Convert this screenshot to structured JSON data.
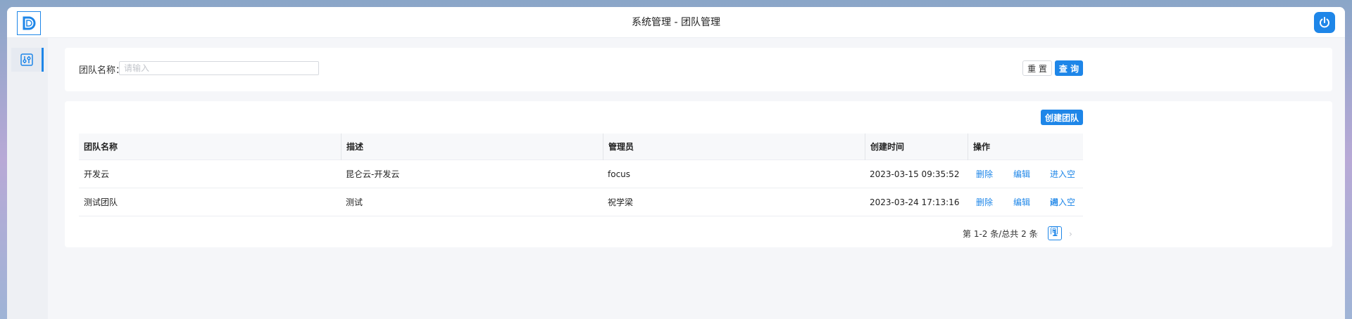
{
  "window": {
    "title": "系统管理 - 团队管理"
  },
  "search": {
    "label": "团队名称：",
    "placeholder": "请输入",
    "value": "",
    "reset_label": "重 置",
    "query_label": "查 询"
  },
  "table": {
    "create_label": "创建团队",
    "columns": [
      "团队名称",
      "描述",
      "管理员",
      "创建时间",
      "操作"
    ],
    "rows": [
      {
        "name": "开发云",
        "description": "昆仑云-开发云",
        "admin": "focus",
        "created": "2023-03-15 09:35:52",
        "actions": {
          "delete": "删除",
          "edit": "编辑",
          "enter": "进入空间"
        }
      },
      {
        "name": "测试团队",
        "description": "测试",
        "admin": "祝学梁",
        "created": "2023-03-24 17:13:16",
        "actions": {
          "delete": "删除",
          "edit": "编辑",
          "enter": "进入空间"
        }
      }
    ]
  },
  "pagination": {
    "summary": "第 1-2 条/总共 2 条",
    "current_page": "1",
    "prev": "‹",
    "next": "›"
  },
  "icons": {
    "logo": "logo-icon",
    "power": "power-icon",
    "settings": "sliders-icon"
  },
  "colors": {
    "accent": "#1e86e8"
  }
}
